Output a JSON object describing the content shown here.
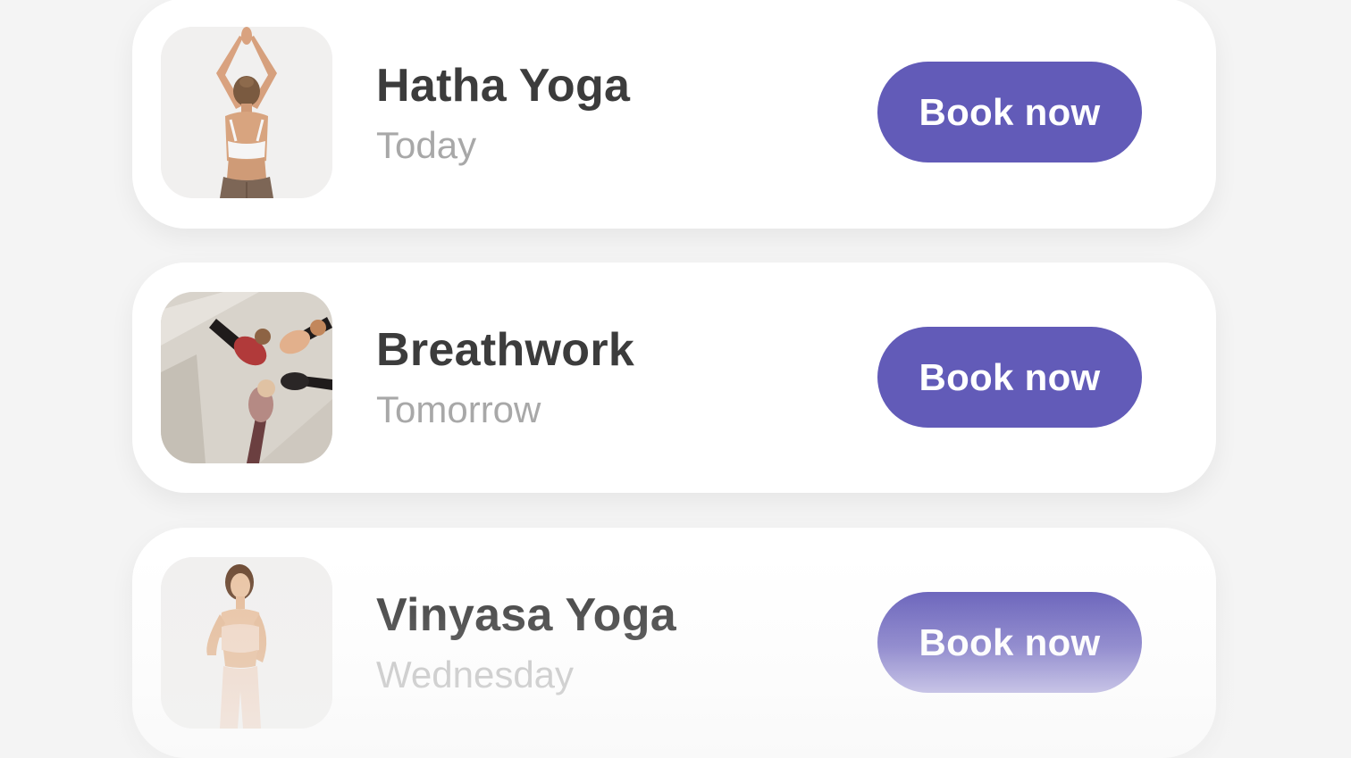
{
  "accent_color": "#625bb8",
  "classes": [
    {
      "title": "Hatha Yoga",
      "day": "Today",
      "button_label": "Book now",
      "image_icon": "woman-hands-overhead-back-view-photo"
    },
    {
      "title": "Breathwork",
      "day": "Tomorrow",
      "button_label": "Book now",
      "image_icon": "group-floor-breathwork-photo"
    },
    {
      "title": "Vinyasa Yoga",
      "day": "Wednesday",
      "button_label": "Book now",
      "image_icon": "woman-standing-activewear-photo"
    }
  ]
}
